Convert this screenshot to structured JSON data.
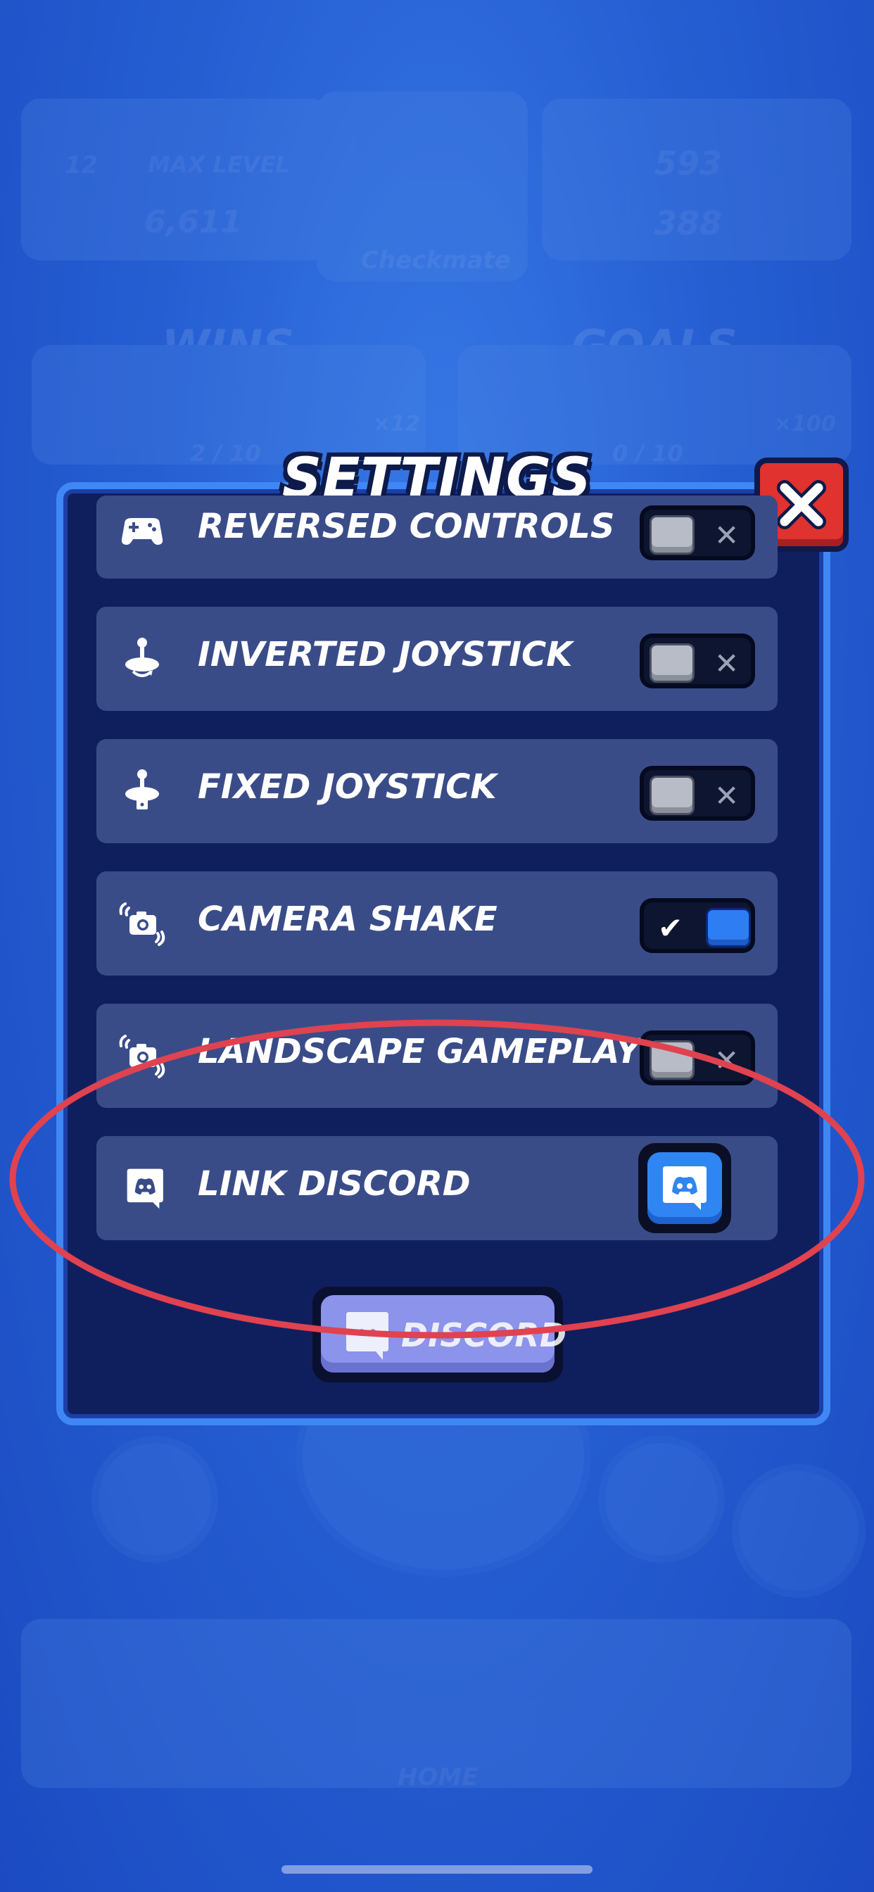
{
  "background": {
    "level_badge": "12",
    "max_level_label": "MAX LEVEL",
    "gems": "6,611",
    "trophies": "593",
    "coins": "388",
    "brawler_name": "Checkmate",
    "wins_title": "WINS",
    "wins_progress": "2 / 10",
    "wins_multiplier": "×12",
    "goals_title": "GOALS",
    "goals_progress": "0 / 10",
    "goals_multiplier": "×100",
    "home_label": "HOME"
  },
  "settings": {
    "title": "SETTINGS",
    "close_label": "close",
    "rows": [
      {
        "label": "REVERSED CONTROLS",
        "icon": "gamepad-icon",
        "state": "off"
      },
      {
        "label": "INVERTED JOYSTICK",
        "icon": "joystick-icon",
        "state": "off"
      },
      {
        "label": "FIXED JOYSTICK",
        "icon": "joystick-lock-icon",
        "state": "off"
      },
      {
        "label": "CAMERA SHAKE",
        "icon": "camera-shake-icon",
        "state": "on"
      },
      {
        "label": "LANDSCAPE GAMEPLAY",
        "icon": "camera-rotate-icon",
        "state": "off"
      },
      {
        "label": "LINK DISCORD",
        "icon": "discord-icon",
        "state": "button"
      }
    ],
    "toggle_on_mark": "✔",
    "toggle_off_mark": "✕",
    "bottom_button_label": "DISCORD"
  },
  "colors": {
    "modal_bg": "#0f1f5e",
    "row_bg": "#3a4c88",
    "accent_blue": "#2f7df3",
    "close_red": "#e0322f",
    "highlight_red": "#e0424f"
  }
}
